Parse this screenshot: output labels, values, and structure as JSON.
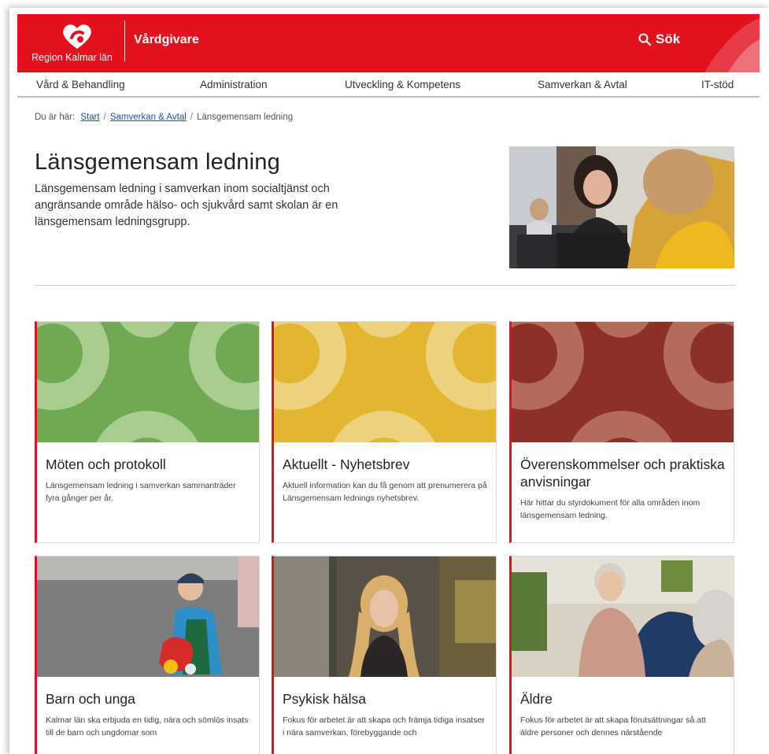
{
  "header": {
    "logo_text": "Region Kalmar län",
    "site_name": "Vårdgivare",
    "search_label": "Sök",
    "brand_color": "#e3101e"
  },
  "nav": {
    "items": [
      {
        "label": "Vård & Behandling"
      },
      {
        "label": "Administration"
      },
      {
        "label": "Utveckling & Kompetens"
      },
      {
        "label": "Samverkan & Avtal"
      },
      {
        "label": "IT-stöd"
      }
    ]
  },
  "breadcrumb": {
    "prefix": "Du är här:",
    "items": [
      {
        "label": "Start"
      },
      {
        "label": "Samverkan & Avtal"
      },
      {
        "label": "Länsgemensam ledning"
      }
    ]
  },
  "page": {
    "title": "Länsgemensam ledning",
    "intro": "Länsgemensam ledning i samverkan inom socialtjänst och angränsande område hälso- och sjukvård samt skolan är en länsgemensam ledningsgrupp."
  },
  "cards": [
    {
      "title": "Möten och protokoll",
      "desc": "Länsgemensam ledning i samverkan sammanträder fyra gånger per år.",
      "color": "#6fa954"
    },
    {
      "title": "Aktuellt - Nyhetsbrev",
      "desc": "Aktuell information kan du få genom att prenumerera på Länsgemensam lednings nyhetsbrev.",
      "color": "#e2b72f"
    },
    {
      "title": "Överenskommelser och praktiska anvisningar",
      "desc": "Här hittar du styrdokument för alla områden inom länsgemensam ledning.",
      "color": "#8c3029"
    },
    {
      "title": "Barn och unga",
      "desc": "Kalmar län ska erbjuda en tidig, nära och sömlös insats till de barn och ungdomar som"
    },
    {
      "title": "Psykisk hälsa",
      "desc": "Fokus för arbetet är att skapa och främja tidiga insatser i nära samverkan, förebyggande och"
    },
    {
      "title": "Äldre",
      "desc": "Fokus för arbetet är att skapa förutsättningar så att äldre personer och dennes närstående"
    }
  ]
}
